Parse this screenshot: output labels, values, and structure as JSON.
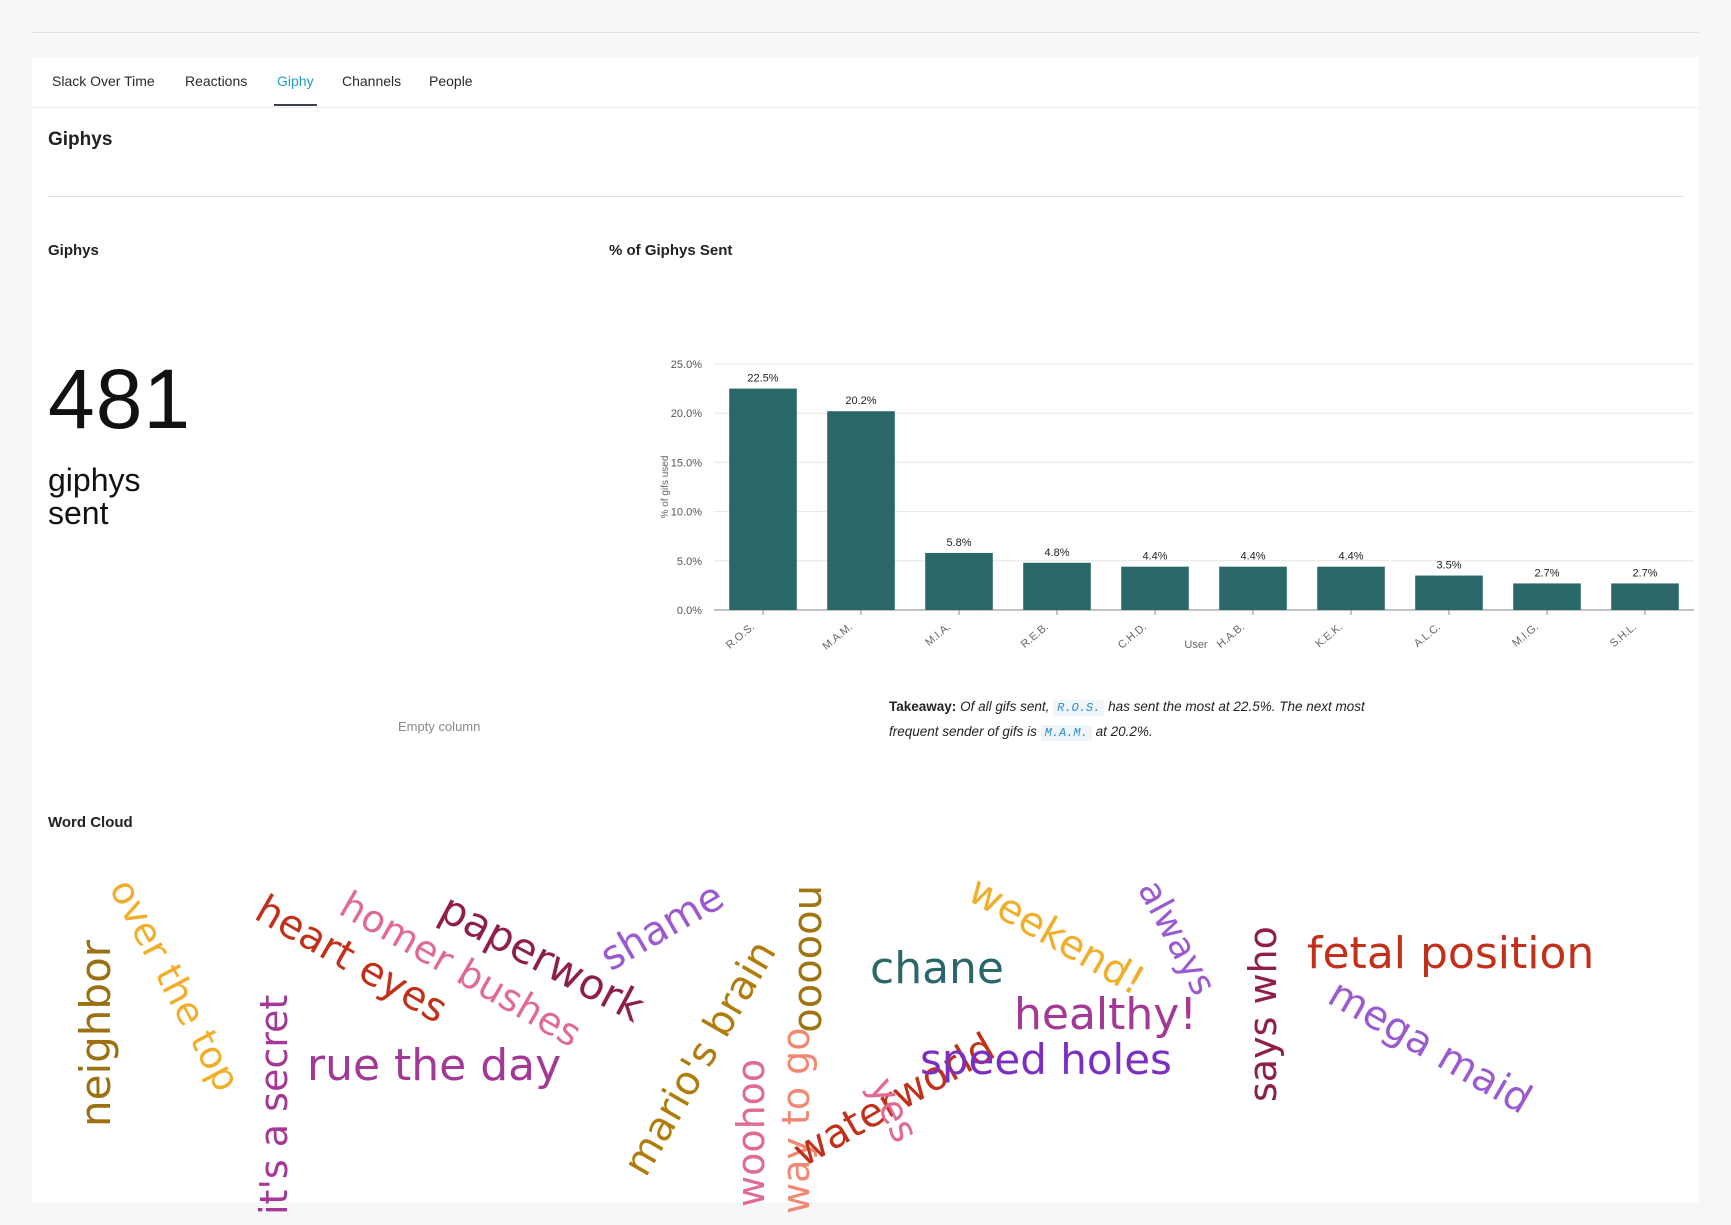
{
  "tabs": [
    {
      "label": "Slack Over Time"
    },
    {
      "label": "Reactions"
    },
    {
      "label": "Giphy"
    },
    {
      "label": "Channels"
    },
    {
      "label": "People"
    }
  ],
  "active_tab": "Giphy",
  "section_title": "Giphys",
  "stat": {
    "heading": "Giphys",
    "value": "481",
    "label_line1": "giphys",
    "label_line2": "sent"
  },
  "empty_column": "Empty column",
  "chart_heading": "% of Giphys Sent",
  "chart_data": {
    "type": "bar",
    "categories": [
      "R.O.S.",
      "M.A.M.",
      "M.I.A.",
      "R.E.B.",
      "C.H.D.",
      "H.A.B.",
      "K.E.K.",
      "A.L.C.",
      "M.I.G.",
      "S.H.L."
    ],
    "values": [
      22.5,
      20.2,
      5.8,
      4.8,
      4.4,
      4.4,
      4.4,
      3.5,
      2.7,
      2.7
    ],
    "data_labels": [
      "22.5%",
      "20.2%",
      "5.8%",
      "4.8%",
      "4.4%",
      "4.4%",
      "4.4%",
      "3.5%",
      "2.7%",
      "2.7%"
    ],
    "yticks": [
      "0.0%",
      "5.0%",
      "10.0%",
      "15.0%",
      "20.0%",
      "25.0%"
    ],
    "xlabel": "User",
    "ylabel": "% of gifs used",
    "ylim": [
      0,
      25
    ],
    "bar_color": "#2a6769",
    "grid": true
  },
  "takeaway": {
    "label": "Takeaway",
    "text1": "Of all gifs sent,",
    "code1": "R.O.S.",
    "text2": "has sent the most at 22.5%. The next most frequent sender of gifs is",
    "code2": "M.A.M.",
    "text3": "at 20.2%."
  },
  "wordcloud_heading": "Word Cloud",
  "wordcloud": [
    {
      "text": "neighbor",
      "color": "#9a7010"
    },
    {
      "text": "over the top",
      "color": "#f1ae2a"
    },
    {
      "text": "it's a secret",
      "color": "#a43896"
    },
    {
      "text": "heart eyes",
      "color": "#c2301a"
    },
    {
      "text": "homer bushes",
      "color": "#e06a92"
    },
    {
      "text": "rue the day",
      "color": "#a43896"
    },
    {
      "text": "paperwork",
      "color": "#8e1e4a"
    },
    {
      "text": "shame",
      "color": "#9b5ad1"
    },
    {
      "text": "mario's brain",
      "color": "#b07d0c"
    },
    {
      "text": "nooooo",
      "color": "#a07410"
    },
    {
      "text": "woohoo",
      "color": "#e06a92"
    },
    {
      "text": "way to go",
      "color": "#f08872"
    },
    {
      "text": "chane",
      "color": "#2a6769"
    },
    {
      "text": "waterworld",
      "color": "#c2301a"
    },
    {
      "text": "yes",
      "color": "#e06a92"
    },
    {
      "text": "weekend!",
      "color": "#f1ae2a"
    },
    {
      "text": "always",
      "color": "#9b5ad1"
    },
    {
      "text": "healthy!",
      "color": "#a43896"
    },
    {
      "text": "speed holes",
      "color": "#7b2fc0"
    },
    {
      "text": "says who",
      "color": "#8e1e4a"
    },
    {
      "text": "fetal position",
      "color": "#c2301a"
    },
    {
      "text": "mega maid",
      "color": "#9b5ad1"
    }
  ]
}
